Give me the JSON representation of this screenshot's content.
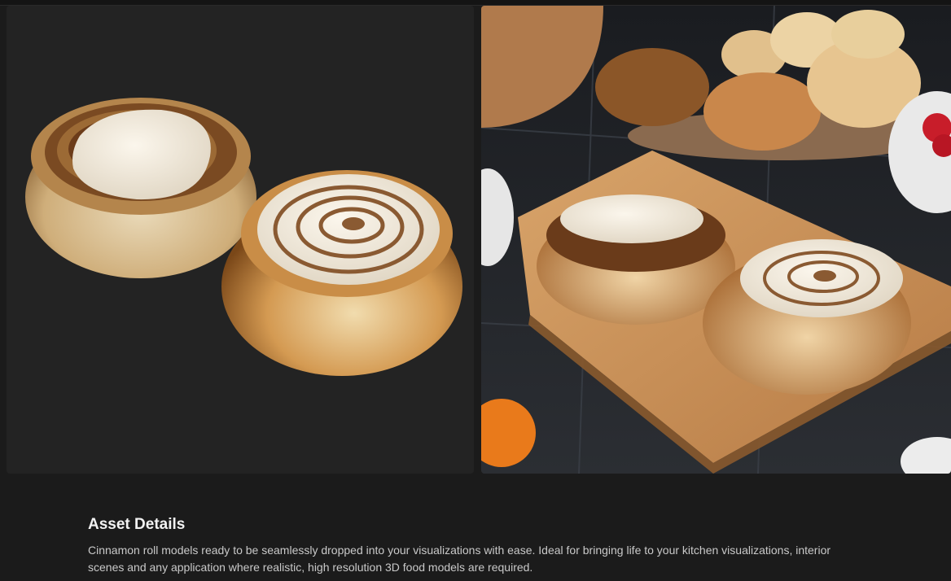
{
  "gallery": {
    "images": [
      {
        "alt": "Two cinnamon roll 3D models on dark background"
      },
      {
        "alt": "Cinnamon rolls on wooden cutting board in kitchen scene"
      }
    ]
  },
  "details": {
    "heading": "Asset Details",
    "description": "Cinnamon roll models ready to be seamlessly dropped into your visualizations with ease. Ideal for bringing life to your kitchen visualizations, interior scenes and any application where realistic, high resolution 3D food models are required."
  }
}
